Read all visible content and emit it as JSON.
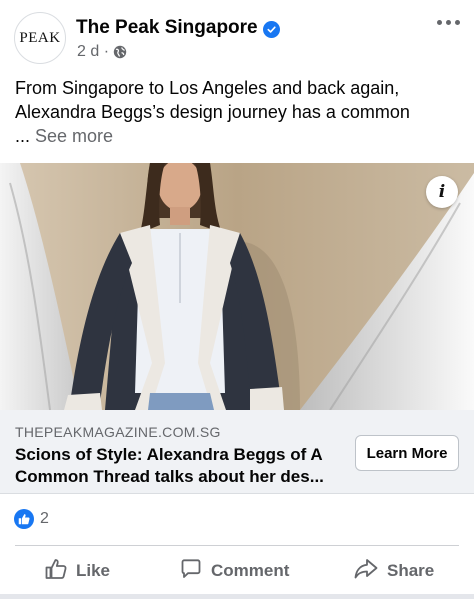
{
  "post": {
    "page_name": "The Peak Singapore",
    "avatar_text": "PEAK",
    "time": "2 d ·",
    "caption_line1": "From Singapore to Los Angeles and back again,",
    "caption_line2": "Alexandra Beggs’s design journey has a common",
    "caption_ellipsis": "... ",
    "see_more": "See more"
  },
  "link_preview": {
    "domain": "THEPEAKMAGAZINE.COM.SG",
    "title_line1": "Scions of Style: Alexandra Beggs of A",
    "title_line2": "Common Thread talks about her des...",
    "cta": "Learn More"
  },
  "reactions": {
    "count": "2"
  },
  "actions": {
    "like": "Like",
    "comment": "Comment",
    "share": "Share"
  },
  "colors": {
    "accent": "#1877f2",
    "secondary_text": "#65676b",
    "link_bg": "#f0f2f5"
  },
  "icons": [
    "verified-badge-icon",
    "globe-icon",
    "more-options-icon",
    "info-icon",
    "like-reaction-icon",
    "thumbs-up-icon",
    "comment-icon",
    "share-icon"
  ]
}
